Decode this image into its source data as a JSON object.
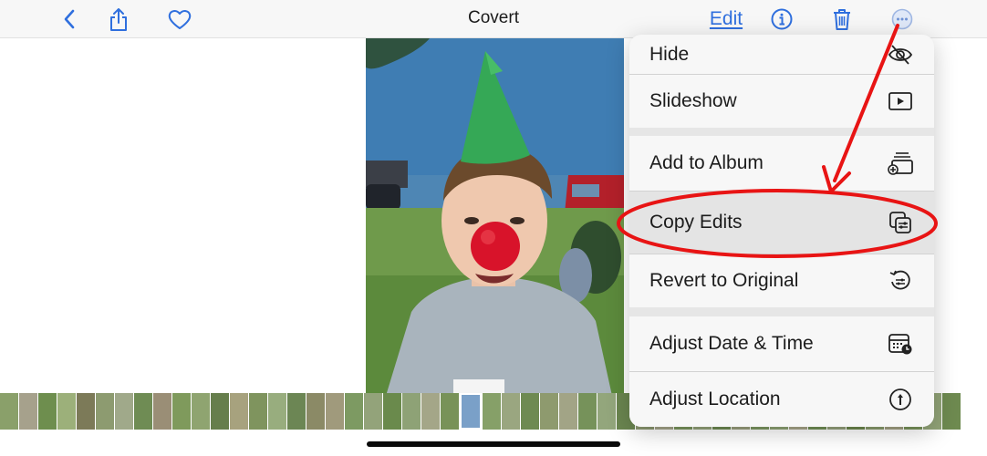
{
  "header": {
    "title": "Covert",
    "edit_label": "Edit",
    "icons": [
      "back-chevron-icon",
      "share-icon",
      "heart-icon",
      "info-icon",
      "trash-icon",
      "more-ellipsis-icon"
    ]
  },
  "menu": {
    "items": [
      {
        "label": "Hide",
        "icon": "eye-slash-icon"
      },
      {
        "label": "Slideshow",
        "icon": "play-rectangle-icon"
      },
      {
        "label": "Add to Album",
        "icon": "add-to-album-icon"
      },
      {
        "label": "Copy Edits",
        "icon": "copy-edits-icon"
      },
      {
        "label": "Revert to Original",
        "icon": "revert-icon"
      },
      {
        "label": "Adjust Date & Time",
        "icon": "calendar-clock-icon"
      },
      {
        "label": "Adjust Location",
        "icon": "location-info-icon"
      }
    ],
    "highlighted": "Copy Edits"
  },
  "colors": {
    "accent": "#2f6fde",
    "annotation": "#e81414",
    "menu_bg": "#f7f7f7",
    "topbar_bg": "#f7f7f7"
  }
}
